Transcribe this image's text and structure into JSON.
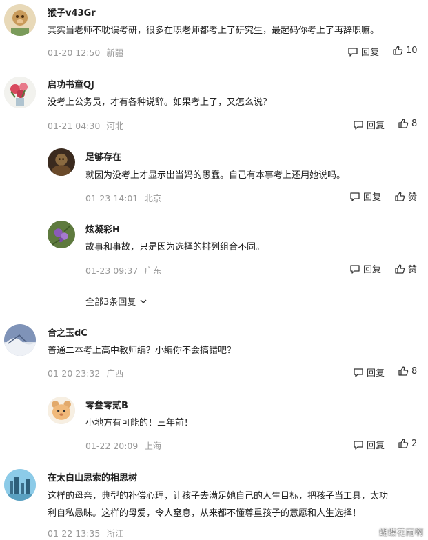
{
  "comments": [
    {
      "user": "猴子v43Gr",
      "text": [
        "其实当老师不耽误考研，很多在职老师都考上了研究生，最起码你考上了再辞职嘛。"
      ],
      "time": "01-20 12:50",
      "location": "新疆",
      "reply_label": "回复",
      "likes": "10"
    },
    {
      "user": "启功书童QJ",
      "text": [
        "没考上公务员，才有各种说辞。如果考上了，又怎么说？"
      ],
      "time": "01-21 04:30",
      "location": "河北",
      "reply_label": "回复",
      "likes": "8",
      "replies": [
        {
          "user": "足够存在",
          "text": [
            "就因为没考上才显示出当妈的愚蠢。自己有本事考上还用她说吗。"
          ],
          "time": "01-23 14:01",
          "location": "北京",
          "reply_label": "回复",
          "likes": "赞"
        },
        {
          "user": "炫凝彩H",
          "text": [
            "故事和事故，只是因为选择的排列组合不同。"
          ],
          "time": "01-23 09:37",
          "location": "广东",
          "reply_label": "回复",
          "likes": "赞"
        }
      ],
      "more_replies": "全部3条回复"
    },
    {
      "user": "合之玉dC",
      "text": [
        "普通二本考上高中教师编？小编你不会搞错吧？"
      ],
      "time": "01-20 23:32",
      "location": "广西",
      "reply_label": "回复",
      "likes": "8",
      "replies": [
        {
          "user": "零叁零贰B",
          "text": [
            "小地方有可能的！三年前！"
          ],
          "time": "01-22 20:09",
          "location": "上海",
          "reply_label": "回复",
          "likes": "2"
        }
      ]
    },
    {
      "user": "在太白山思索的相思树",
      "text": [
        "这样的母亲，典型的补偿心理，让孩子去满足她自己的人生目标，把孩子当工具，太功",
        "利自私愚昧。这样的母爱，令人窒息，从来都不懂尊重孩子的意愿和人生选择！"
      ],
      "time": "01-22 13:35",
      "location": "浙江"
    }
  ],
  "watermark": "蝴蝶花雨啊",
  "colors": {
    "text": "#222222",
    "meta": "#999999",
    "action": "#333333"
  },
  "icons": {
    "reply": "comment-bubble-icon",
    "like": "thumbs-up-icon",
    "expand": "chevron-down-icon"
  }
}
